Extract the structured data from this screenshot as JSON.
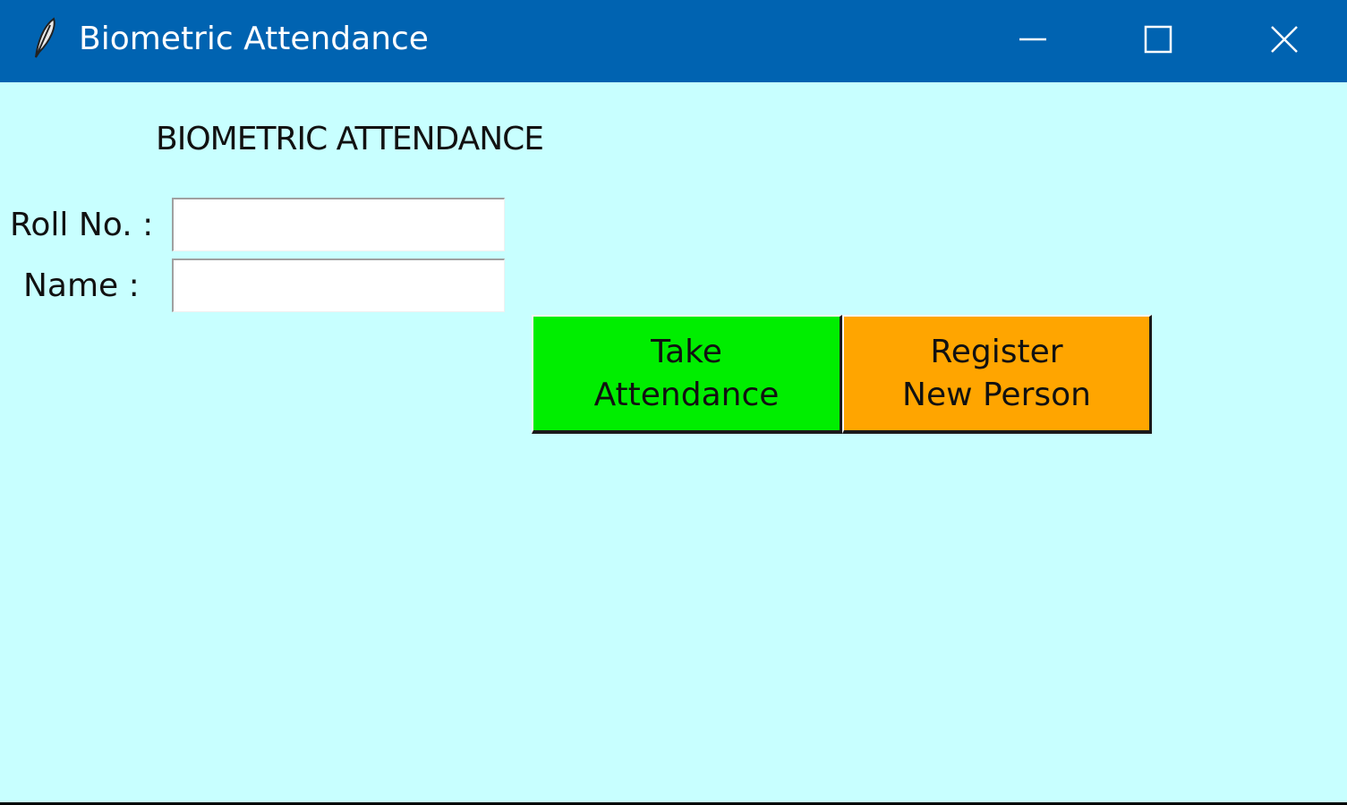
{
  "window": {
    "title": "Biometric Attendance",
    "icon": "feather-icon",
    "controls": {
      "minimize": "minimize-icon",
      "maximize": "maximize-icon",
      "close": "close-icon"
    }
  },
  "form": {
    "heading": "BIOMETRIC ATTENDANCE",
    "roll_label": "Roll No. :",
    "roll_value": "",
    "name_label": "Name :",
    "name_value": ""
  },
  "buttons": {
    "take_attendance": {
      "line1": "Take",
      "line2": "Attendance",
      "color": "#00ee00"
    },
    "register": {
      "line1": "Register",
      "line2": "New Person",
      "color": "#ffa500"
    }
  },
  "colors": {
    "titlebar": "#0063b1",
    "background": "#c8ffff"
  }
}
